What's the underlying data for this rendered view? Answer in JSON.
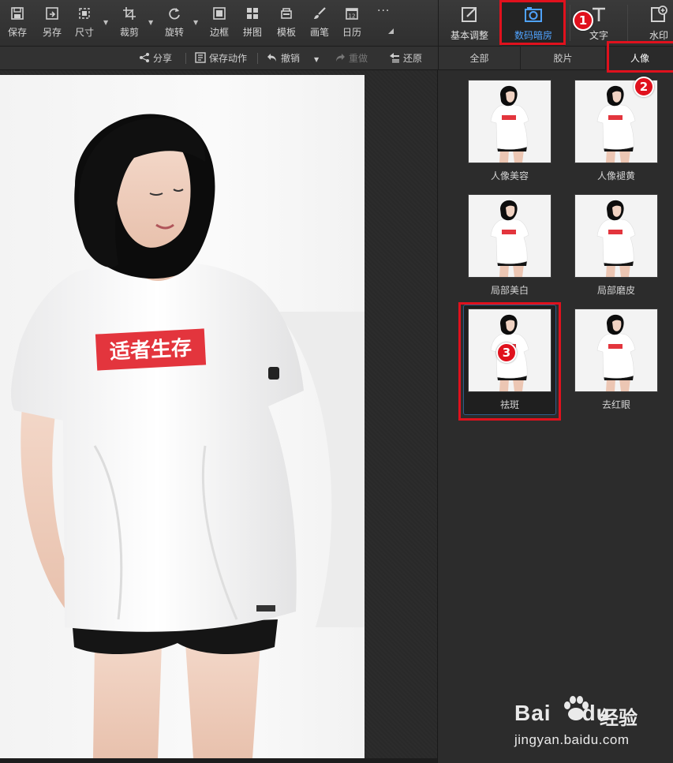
{
  "toolbar": {
    "items": [
      {
        "label": "保存",
        "icon": "save-icon"
      },
      {
        "label": "另存",
        "icon": "save-as-icon"
      },
      {
        "label": "尺寸",
        "icon": "resize-icon"
      },
      {
        "label": "裁剪",
        "icon": "crop-icon"
      },
      {
        "label": "旋转",
        "icon": "rotate-icon"
      },
      {
        "label": "边框",
        "icon": "border-icon"
      },
      {
        "label": "拼图",
        "icon": "collage-icon"
      },
      {
        "label": "模板",
        "icon": "template-icon"
      },
      {
        "label": "画笔",
        "icon": "brush-icon"
      },
      {
        "label": "日历",
        "icon": "calendar-icon"
      }
    ],
    "more": "···"
  },
  "right_tabs": [
    {
      "label": "基本调整",
      "icon": "basic-adjust-icon"
    },
    {
      "label": "数码暗房",
      "icon": "camera-icon",
      "active": true
    },
    {
      "label": "文字",
      "icon": "text-icon"
    },
    {
      "label": "水印",
      "icon": "watermark-icon"
    }
  ],
  "actions": {
    "share": "分享",
    "save_action": "保存动作",
    "undo": "撤销",
    "redo": "重做",
    "restore": "还原"
  },
  "categories": [
    {
      "label": "全部"
    },
    {
      "label": "胶片"
    },
    {
      "label": "人像",
      "active": true
    }
  ],
  "effects": [
    {
      "label": "人像美容"
    },
    {
      "label": "人像褪黄"
    },
    {
      "label": "局部美白"
    },
    {
      "label": "局部磨皮"
    },
    {
      "label": "祛斑",
      "selected": true
    },
    {
      "label": "去红眼"
    }
  ],
  "photo": {
    "shirt_text": "适者生存"
  },
  "annotations": {
    "badge1": "1",
    "badge2": "2",
    "badge3": "3",
    "color": "#e0111d"
  },
  "watermark": {
    "brand": "Bai",
    "brand_tail": "du",
    "jingyan": "经验",
    "url": "jingyan.baidu.com"
  },
  "colors": {
    "active_tab_text": "#4fa3ff",
    "annotation_red": "#e0111d"
  }
}
